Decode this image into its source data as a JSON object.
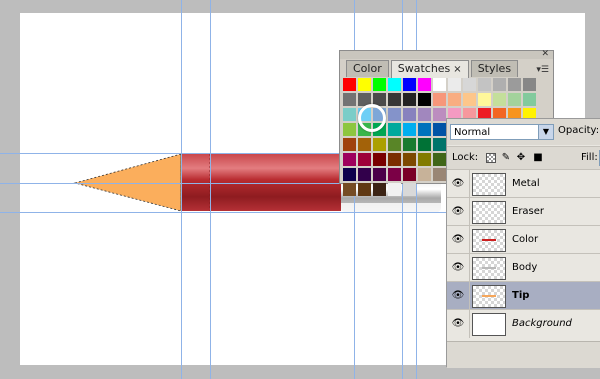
{
  "swatches_panel": {
    "tabs": [
      {
        "label": "Color"
      },
      {
        "label": "Swatches",
        "close": "×"
      },
      {
        "label": "Styles"
      }
    ],
    "close_icon": "close-icon",
    "menu_icon": "panel-menu-icon",
    "colors": [
      "#ff0000",
      "#ffff00",
      "#00ff00",
      "#00ffff",
      "#0000ff",
      "#ff00ff",
      "#ffffff",
      "#ebebeb",
      "#d7d7d7",
      "#c3c3c3",
      "#afafaf",
      "#9b9b9b",
      "#878787",
      "#737373",
      "#5f5f5f",
      "#4b4b4b",
      "#373737",
      "#232323",
      "#000000",
      "#f7977a",
      "#f9ad81",
      "#fdc68a",
      "#fff79a",
      "#c4df9b",
      "#a3d39c",
      "#82ca9d",
      "#7bcdc8",
      "#6ecff6",
      "#7ea7d8",
      "#8493ca",
      "#8882be",
      "#a187be",
      "#bc8dbf",
      "#f49ac2",
      "#f6989d",
      "#ed1c24",
      "#f26522",
      "#f7941d",
      "#fff200",
      "#8dc63f",
      "#39b54a",
      "#00a651",
      "#00a99d",
      "#00aeef",
      "#0072bc",
      "#0054a6",
      "#2e3192",
      "#662d91",
      "#92278f",
      "#ec008c",
      "#ed145b",
      "#9e0b0f",
      "#a0410d",
      "#a36209",
      "#aba000",
      "#598527",
      "#197b30",
      "#007236",
      "#00746b",
      "#0076a3",
      "#004b80",
      "#003471",
      "#1b1464",
      "#440e62",
      "#630460",
      "#9e005d",
      "#9e0039",
      "#790000",
      "#7b2e00",
      "#7d4900",
      "#827b00",
      "#406618",
      "#005e20",
      "#005826",
      "#005952",
      "#005b7f",
      "#003663",
      "#002157",
      "#0d004c",
      "#32004b",
      "#4b0049",
      "#7b0046",
      "#7a0026",
      "#c7b299",
      "#998675",
      "#736357",
      "#534741",
      "#37302d",
      "#c69c6d",
      "#a67c52",
      "#8c6239",
      "#754c24",
      "#603913",
      "#3c2415",
      "#f2f2f2",
      "#d9d9d9"
    ]
  },
  "layers_panel": {
    "blend_mode": "Normal",
    "opacity_label": "Opacity:",
    "lock_label": "Lock:",
    "fill_label": "Fill:",
    "layers": [
      {
        "name": "Metal",
        "selected": false,
        "style": "normal",
        "thumb": "transparent",
        "mark_color": ""
      },
      {
        "name": "Eraser",
        "selected": false,
        "style": "normal",
        "thumb": "transparent",
        "mark_color": ""
      },
      {
        "name": "Color",
        "selected": false,
        "style": "normal",
        "thumb": "transparent",
        "mark_color": "#cc1f1f"
      },
      {
        "name": "Body",
        "selected": false,
        "style": "normal",
        "thumb": "transparent",
        "mark_color": "#b9b9b9"
      },
      {
        "name": "Tip",
        "selected": true,
        "style": "bold",
        "thumb": "transparent",
        "mark_color": "#f5a65b"
      },
      {
        "name": "Background",
        "selected": false,
        "style": "italic",
        "thumb": "white",
        "mark_color": ""
      }
    ]
  },
  "canvas": {
    "background": "#ffffff",
    "tip_color": "#fbae5c",
    "body_color": "#b8282d",
    "ferrule_color": "#bfbfbf"
  },
  "icons": {
    "eye": "eye-icon",
    "lock_transparent": "lock-transparent-icon",
    "lock_paint": "lock-paint-icon",
    "lock_move": "lock-move-icon",
    "lock_all": "lock-all-icon"
  }
}
